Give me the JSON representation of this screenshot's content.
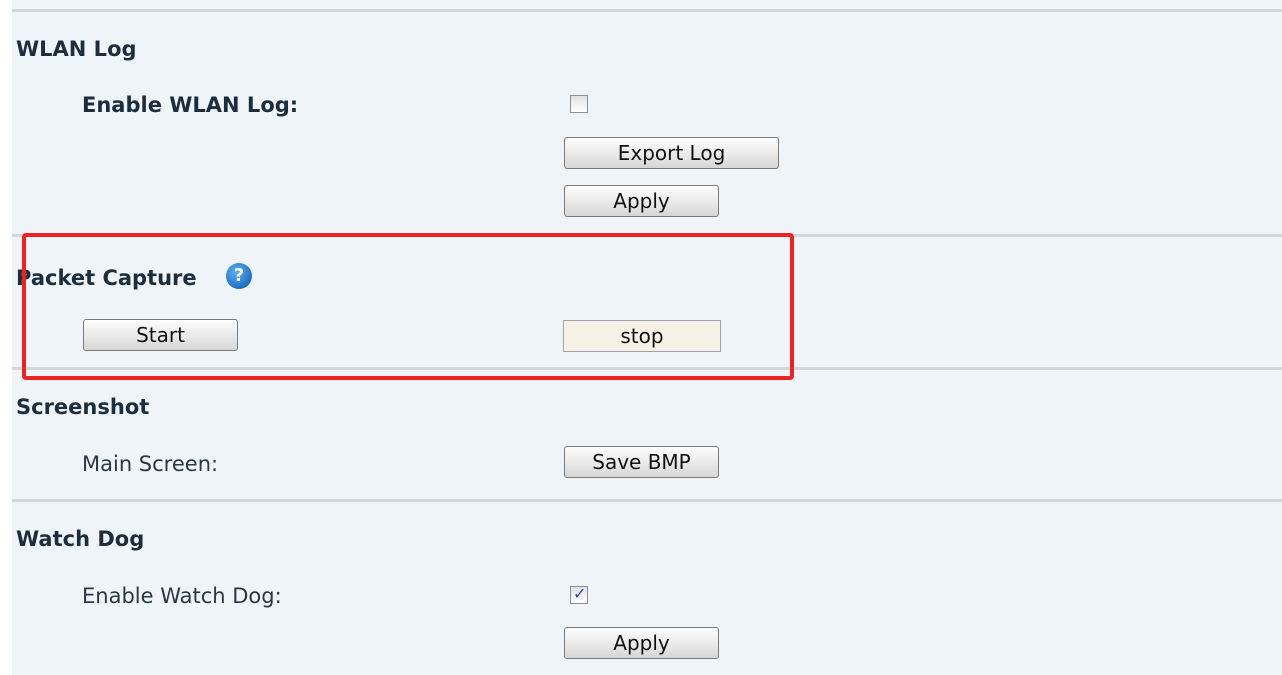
{
  "wlan_log": {
    "title": "WLAN Log",
    "enable_label": "Enable WLAN Log:",
    "enable_checked": false,
    "export_button": "Export Log",
    "apply_button": "Apply"
  },
  "packet_capture": {
    "title": "Packet Capture",
    "help_glyph": "?",
    "start_button": "Start",
    "stop_button": "stop"
  },
  "screenshot": {
    "title": "Screenshot",
    "main_screen_label": "Main Screen:",
    "save_button": "Save BMP"
  },
  "watch_dog": {
    "title": "Watch Dog",
    "enable_label": "Enable Watch Dog:",
    "enable_checked": true,
    "check_glyph": "✓",
    "apply_button": "Apply"
  },
  "colors": {
    "panel_background": "#eef4f8",
    "highlight_border": "#ee2222",
    "help_icon": "#1e6fc1"
  },
  "icons": {
    "help": "help-question-icon",
    "checkbox": "checkbox-icon"
  }
}
